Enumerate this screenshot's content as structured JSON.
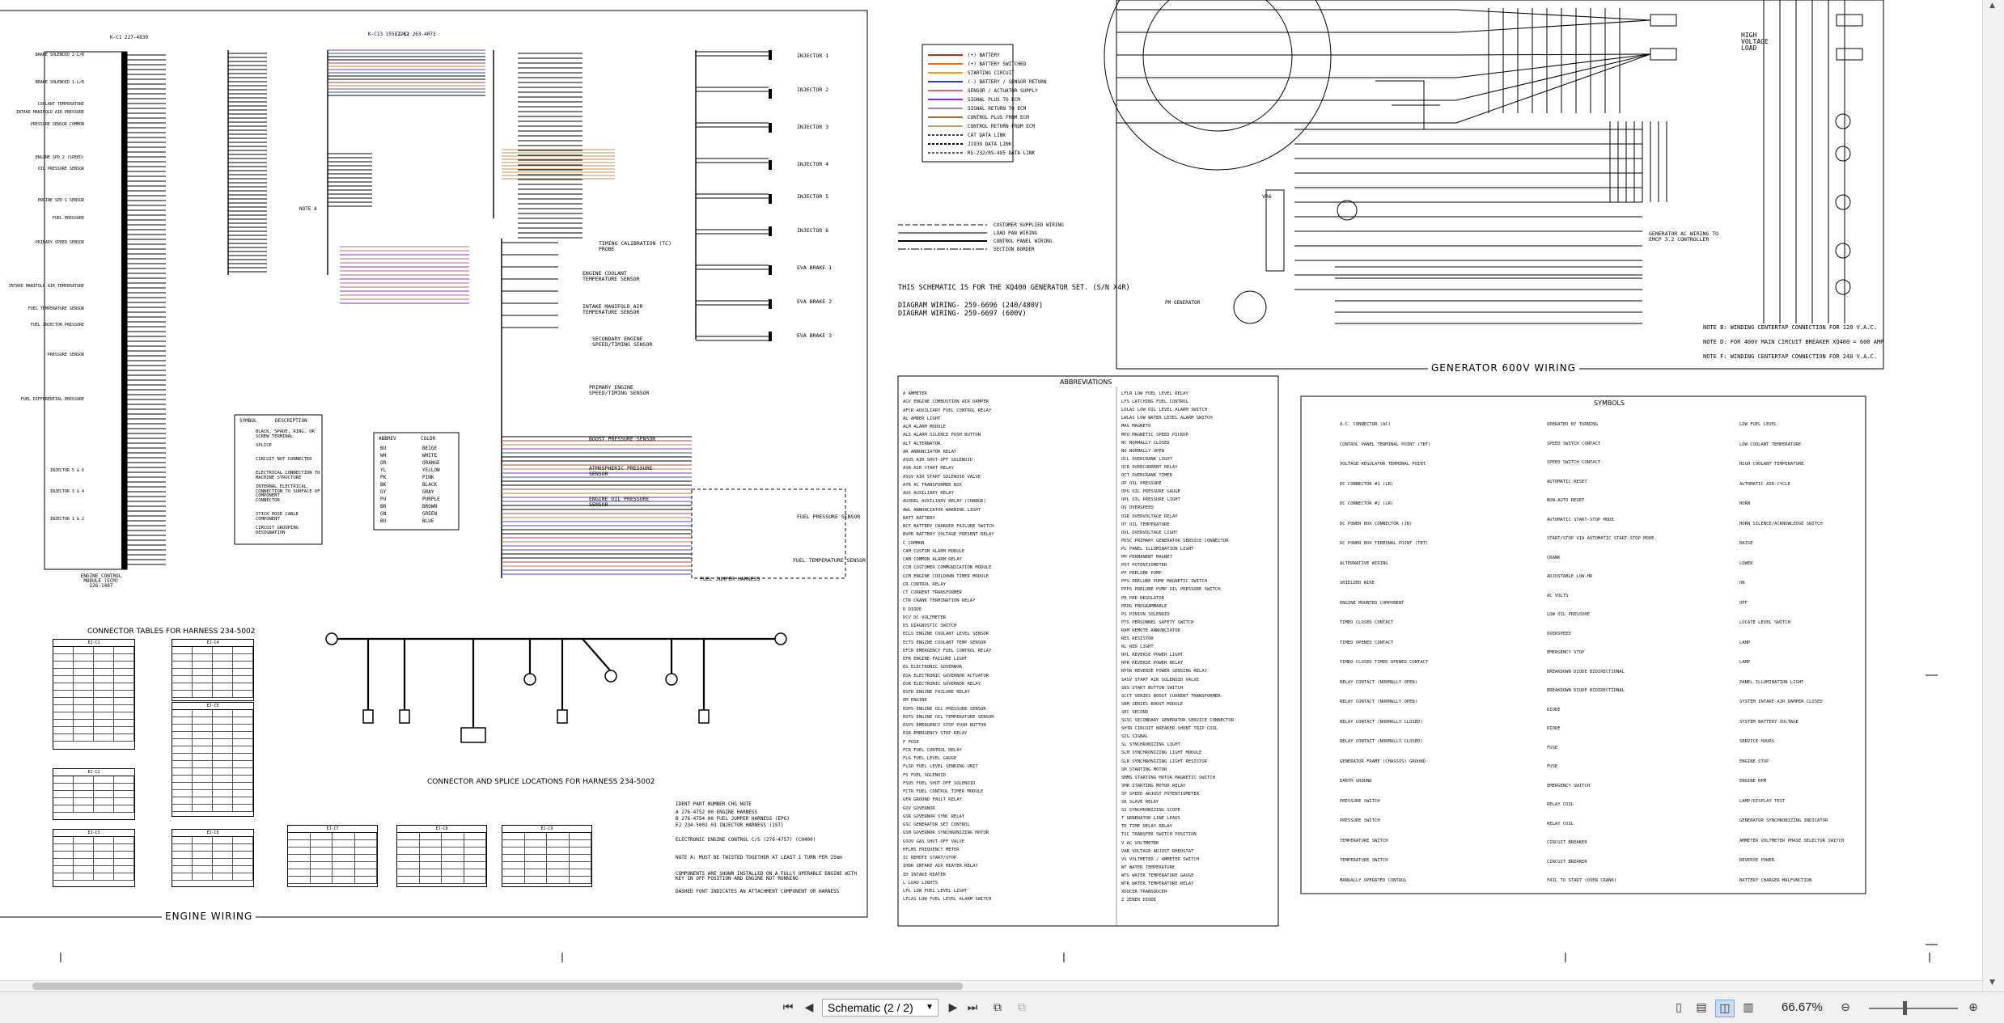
{
  "engine_wiring": {
    "title": "ENGINE WIRING",
    "ecm_label": "ENGINE CONTROL MODULE (ECM) 226-1487",
    "harness_left": "K-C1 227-4830",
    "harness_mid": "K-C13 155-2262",
    "harness_mid2": "EJ-C1 263-4073",
    "left_labels": [
      "BRAKE SOLENOID 2-L/R",
      "BRAKE SOLENOID 1-L/R",
      "COOLANT TEMPERATURE",
      "INTAKE MANIFOLD AIR PRESSURE",
      "PRESSURE SENSOR COMMON",
      "ENGINE SPD 2 (SPEED)",
      "OIL PRESSURE SENSOR",
      "ENGINE SPD 1 SENSOR",
      "FUEL PRESSURE",
      "PRIMARY SPEED SENSOR",
      "INTAKE MANIFOLD AIR TEMPERATURE",
      "FUEL TEMPERATURE SENSOR",
      "FUEL INJECTOR PRESSURE",
      "PRESSURE SENSOR",
      "FUEL DIFFERENTIAL PRESSURE",
      "INJECTOR 5 & 6",
      "INJECTOR 3 & 4",
      "INJECTOR 1 & 2"
    ],
    "components": [
      "TIMING CALIBRATION (TC) PROBE",
      "ENGINE COOLANT TEMPERATURE SENSOR",
      "INTAKE MANIFOLD AIR TEMPERATURE SENSOR",
      "SECONDARY ENGINE SPEED/TIMING SENSOR",
      "PRIMARY ENGINE SPEED/TIMING SENSOR",
      "BOOST PRESSURE SENSOR",
      "ATMOSPHERIC PRESSURE SENSOR",
      "ENGINE OIL PRESSURE SENSOR",
      "FUEL PRESSURE SENSOR",
      "FUEL TEMPERATURE SENSOR",
      "FUEL JUMPER HARNESS"
    ],
    "injectors": [
      "INJECTOR 1",
      "INJECTOR 2",
      "INJECTOR 3",
      "INJECTOR 4",
      "INJECTOR 5",
      "INJECTOR 6",
      "EVA BRAKE 1",
      "EVA BRAKE 2",
      "EVA BRAKE 3"
    ],
    "note_a": "NOTE A",
    "symbol_box": {
      "header": [
        "SYMBOL",
        "DESCRIPTION"
      ],
      "rows": [
        "BLACK, SPADE, RING, OR SCREW TERMINAL",
        "SPLICE",
        "CIRCUIT NOT CONNECTED",
        "ELECTRICAL CONNECTION TO MACHINE STRUCTURE",
        "INTERNAL ELECTRICAL CONNECTION TO SURFACE OF COMPONENT",
        "CONNECTOR",
        "STICK HOSE CABLE COMPONENT",
        "CIRCUIT GROUPING DESIGNATION"
      ]
    },
    "color_box": {
      "header": [
        "ABBREV",
        "COLOR"
      ],
      "rows": [
        [
          "BU",
          "BEIGE"
        ],
        [
          "WH",
          "WHITE"
        ],
        [
          "OR",
          "ORANGE"
        ],
        [
          "YL",
          "YELLOW"
        ],
        [
          "PK",
          "PINK"
        ],
        [
          "BK",
          "BLACK"
        ],
        [
          "GY",
          "GRAY"
        ],
        [
          "PU",
          "PURPLE"
        ],
        [
          "BR",
          "BROWN"
        ],
        [
          "GN",
          "GREEN"
        ],
        [
          "BU",
          "BLUE"
        ]
      ]
    }
  },
  "harness": {
    "connector_title": "CONNECTOR TABLES FOR HARNESS 234-5002",
    "location_title": "CONNECTOR AND SPLICE LOCATIONS FOR HARNESS 234-5002",
    "tables": [
      "EJ-C1",
      "EJ-C4",
      "EJ-C2",
      "EJ-C5",
      "EJ-C3",
      "EJ-C6",
      "EJ-C7",
      "EJ-C8",
      "EJ-C9"
    ]
  },
  "legend": {
    "rows": [
      "(+) BATTERY",
      "(+) BATTERY SWITCHED",
      "STARTING CIRCUIT",
      "(-) BATTERY / SENSOR RETURN",
      "SENSOR / ACTUATOR SUPPLY",
      "SIGNAL PLUS TO ECM",
      "SIGNAL RETURN TO ECM",
      "CONTROL PLUS FROM ECM",
      "CONTROL RETURN FROM ECM",
      "CAT DATA LINK",
      "J1939 DATA LINK",
      "RS-232/RS-485 DATA LINK"
    ],
    "lines": [
      "CUSTOMER SUPPLIED WIRING",
      "LOAD PAN WIRING",
      "CONTROL PANEL WIRING",
      "SECTION BORDER"
    ],
    "schematic_note": "THIS SCHEMATIC IS FOR THE XQ400 GENERATOR SET. (S/N X4R)",
    "diagram1": "DIAGRAM WIRING- 259-6696 (240/480V)",
    "diagram2": "DIAGRAM WIRING- 259-6697 (600V)"
  },
  "generator": {
    "title": "GENERATOR 600V WIRING",
    "high_voltage": "HIGH VOLTAGE LOAD",
    "ac_wiring": "GENERATOR AC WIRING TO EMCP 3.2 CONTROLLER",
    "vr": "VR6",
    "pm": "PM GENERATOR",
    "notes": [
      "NOTE B: WINDING CENTERTAP CONNECTION FOR 120 V.A.C.",
      "NOTE D: FOR 400V MAIN CIRCUIT BREAKER XQ400 = 600 AMP",
      "NOTE F: WINDING CENTERTAP CONNECTION FOR 240 V.A.C."
    ]
  },
  "abbreviations": {
    "title": "ABBREVIATIONS",
    "col1": [
      "A  AMMETER",
      "ACV  ENGINE COMBUSTION AIR DAMPER",
      "AFCR  AUXILIARY FUEL CONTROL RELAY",
      "AL  AMBER LIGHT",
      "ALM  ALARM MODULE",
      "ALS  ALARM SILENCE PUSH BUTTON",
      "ALT  ALTERNATOR",
      "AR  ANNUNCIATOR RELAY",
      "ASOS  AIR SHUT-OFF SOLENOID",
      "ASR  AIR START RELAY",
      "ASSV  AIR START SOLENOID VALVE",
      "ATR  AC TRANSFORMER BOX",
      "AUX  AUXILIARY RELAY",
      "AUXREL  AUXILIARY RELAY (CHANGE)",
      "AWL  ANNUNCIATOR WARNING LIGHT",
      "BATT  BATTERY",
      "BCF  BATTERY CHARGER FAILURE SWITCH",
      "BVPR  BATTERY VOLTAGE PRESENT RELAY",
      "C  COMMON",
      "CAM  CUSTOM ALARM MODULE",
      "CAM  COMMON ALARM RELAY",
      "CCM  CUSTOMER COMMUNICATION MODULE",
      "CCM  ENGINE COOLDOWN TIMER MODULE",
      "CR  CONTROL RELAY",
      "CT  CURRENT TRANSFORMER",
      "CTR  CRANK TERMINATION RELAY",
      "D  DIODE",
      "DCV  DC VOLTMETER",
      "DS  DIAGNOSTIC SWITCH",
      "ECLS  ENGINE COOLANT LEVEL SENSOR",
      "ECTS  ENGINE COOLANT TEMP SENSOR",
      "EFCR  EMERGENCY FUEL CONTROL RELAY",
      "EFR  ENGINE FAILURE LIGHT",
      "EG  ELECTRONIC GOVERNOR",
      "EGA  ELECTRONIC GOVERNOR ACTUATOR",
      "EGR  ELECTRONIC GOVERNOR RELAY",
      "EGFR  ENGINE FAILURE RELAY",
      "EM  ENGINE",
      "EOPS  ENGINE OIL PRESSURE SENSOR",
      "EOTS  ENGINE OIL TEMPERATURE SENSOR",
      "ESPS  EMERGENCY STOP PUSH BUTTON",
      "ESR  EMERGENCY STOP RELAY",
      "F  FUSE",
      "FCR  FUEL CONTROL RELAY",
      "FLG  FUEL LEVEL GAUGE",
      "FLSD  FUEL LEVEL SENDING UNIT",
      "FS  FUEL SOLENOID",
      "FSOS  FUEL SHUT-OFF SOLENOID",
      "FCTR  FUEL CONTROL TIMER MODULE",
      "GFR  GROUND FAULT RELAY",
      "GOV  GOVERNOR",
      "GSR  GOVERNOR SYNC RELAY",
      "GSC  GENERATOR SET CONTROL",
      "GSM  GOVERNOR SYNCHRONIZING MOTOR",
      "GSOV  GAS SHUT-OFF VALVE",
      "HFLMS  FREQUENCY METER",
      "IC  REMOTE START/STOP",
      "IHDR  INTAKE AIR HEATER RELAY",
      "IH  INTAKE HEATER",
      "L  LOAD LIGHTS",
      "LFL  LOW FUEL LEVEL LIGHT",
      "LFLAS  LOW FUEL LEVEL ALARM SWITCH"
    ],
    "col2": [
      "LFLR  LOW FUEL LEVEL RELAY",
      "LFS  LATCHING FUEL CONTROL",
      "LOLAS  LOW OIL LEVEL ALARM SWITCH",
      "LWLAS  LOW WATER LEVEL ALARM SWITCH",
      "MAG  MAGNETO",
      "MPU  MAGNETIC SPEED PICKUP",
      "NC  NORMALLY CLOSED",
      "NO  NORMALLY OPEN",
      "OCL  OVERCRANK LIGHT",
      "OCR  OVERCURRENT RELAY",
      "OCT  OVERCRANK TIMER",
      "OP  OIL PRESSURE",
      "OPG  OIL PRESSURE GAUGE",
      "OPL  OIL PRESSURE LIGHT",
      "OS  OVERSPEED",
      "OSR  OVERVOLTAGE RELAY",
      "OT  OIL TEMPERATURE",
      "OVL  OVERVOLTAGE LIGHT",
      "PDSC  PRIMARY GENERATOR SERVICE CONNECTOR",
      "PL  PANEL ILLUMINATION LIGHT",
      "PM  PERMANENT MAGNET",
      "POT  POTENTIOMETER",
      "PP  PRELUBE PUMP",
      "PPS  PRELUBE PUMP MAGNETIC SWITCH",
      "PPPS  PRELUBE PUMP OIL PRESSURE SWITCH",
      "PR  PRE-REGULATOR",
      "PROG  PROGRAMMABLE",
      "PS  PINION SOLENOID",
      "PTS  PERSONNEL SAFETY SWITCH",
      "RAM  REMOTE ANNUNCIATOR",
      "RES  RESISTOR",
      "RL  RED LIGHT",
      "RPL  REVERSE POWER LIGHT",
      "RPR  REVERSE POWER RELAY",
      "RPSR  REVERSE POWER SENSING RELAY",
      "SASV  START AIR SOLENOID VALVE",
      "SBS  START BUTTON SWITCH",
      "SCCT  SERIES BOOST CURRENT TRANSFORMER",
      "SBM  SERIES BOOST MODULE",
      "SEC  SECOND",
      "SGSC  SECONDARY GENERATOR SERVICE CONNECTOR",
      "SHTR  CIRCUIT BREAKER SHUNT TRIP COIL",
      "SIG  SIGNAL",
      "SL  SYNCHRONIZING LIGHT",
      "SLM  SYNCHRONIZING LIGHT MODULE",
      "SLR  SYNCHRONIZING LIGHT RESISTOR",
      "SM  STARTING MOTOR",
      "SMMS  STARTING MOTOR MAGNETIC SWITCH",
      "SMR  STARTING MOTOR RELAY",
      "SP  SPEED ADJUST POTENTIOMETER",
      "SR  SLAVE RELAY",
      "SS  SYNCHRONIZING SCOPE",
      "T  GENERATOR LINE LEADS",
      "TD  TIME DELAY RELAY",
      "TSC  TRANSFER SWITCH POSITION",
      "V  AC VOLTMETER",
      "VAR  VOLTAGE ADJUST RHEOSTAT",
      "VS  VOLTMETER / AMMETER SWITCH",
      "WT  WATER TEMPERATURE",
      "WTG  WATER TEMPERATURE GAUGE",
      "WTR  WATER TEMPERATURE RELAY",
      "XDUCER  TRANSDUCER",
      "Z  ZENER DIODE"
    ]
  },
  "symbols": {
    "title": "SYMBOLS",
    "col1": [
      "A.C. CONNECTOR (AC)",
      "CONTROL PANEL TERMINAL POINT (TBT)",
      "VOLTAGE REGULATOR TERMINAL POINT",
      "DC CONNECTOR #1 (LR)",
      "DC CONNECTOR #2 (LR)",
      "DC POWER BOX CONNECTOR (JB)",
      "DC POWER BOX TERMINAL POINT (TBT)",
      "ALTERNATIVE WIRING",
      "SHIELDED WIRE",
      "ENGINE MOUNTED COMPONENT",
      "TIMED CLOSED CONTACT",
      "TIMED OPENED CONTACT",
      "TIMED CLOSED TIMED OPENED CONTACT",
      "RELAY CONTACT (NORMALLY OPEN)",
      "RELAY CONTACT (NORMALLY OPEN)",
      "RELAY CONTACT (NORMALLY CLOSED)",
      "RELAY CONTACT (NORMALLY CLOSED)",
      "GENERATOR FRAME (CHASSIS) GROUND",
      "EARTH GROUND",
      "PRESSURE SWITCH",
      "PRESSURE SWITCH",
      "TEMPERATURE SWITCH",
      "TEMPERATURE SWITCH",
      "MANUALLY OPERATED CONTROL"
    ],
    "col2": [
      "OPERATED BY TURNING",
      "SPEED SWITCH CONTACT",
      "SPEED SWITCH CONTACT",
      "AUTOMATIC RESET",
      "NON-AUTO RESET",
      "AUTOMATIC START-STOP MODE",
      "START/STOP VIA AUTOMATIC START-STOP MODE",
      "CRANK",
      "ADJUSTABLE LOW-HR",
      "AC VOLTS",
      "LOW OIL PRESSURE",
      "OVERSPEED",
      "EMERGENCY STOP",
      "BREAKDOWN DIODE BIDIRECTIONAL",
      "BREAKDOWN DIODE BIDIRECTIONAL",
      "DIODE",
      "DIODE",
      "FUSE",
      "FUSE",
      "EMERGENCY SWITCH",
      "RELAY COIL",
      "RELAY COIL",
      "CIRCUIT BREAKER",
      "CIRCUIT BREAKER",
      "FAIL TO START (OVER CRANK)"
    ],
    "col3": [
      "LOW FUEL LEVEL",
      "LOW COOLANT TEMPERATURE",
      "HIGH COOLANT TEMPERATURE",
      "AUTOMATIC AIR-CYCLE",
      "HORN",
      "HORN SILENCE/ACKNOWLEDGE SWITCH",
      "RAISE",
      "LOWER",
      "ON",
      "OFF",
      "LOCATE LEVEL SWITCH",
      "LAMP",
      "LAMP",
      "PANEL ILLUMINATION LIGHT",
      "SYSTEM INTAKE AIR DAMPER CLOSED",
      "SYSTEM BATTERY VOLTAGE",
      "SERVICE HOURS",
      "ENGINE STOP",
      "ENGINE RPM",
      "LAMP/DISPLAY TEST",
      "GENERATOR SYNCHRONIZING INDICATOR",
      "AMMETER VOLTMETER PHASE SELECTOR SWITCH",
      "REVERSE POWER",
      "BATTERY CHARGER MALFUNCTION"
    ]
  },
  "notes": {
    "part_table_header": "IDENT  PART NUMBER  CHG  NOTE",
    "parts": [
      "A  276-4752  00  ENGINE HARNESS",
      "B  276-4754  00  FUEL JUMPER HARNESS (EPG)",
      "EJ  234-5002  03  INJECTOR HARNESS (1ST)"
    ],
    "ecm_note": "ELECTRONIC ENGINE CONTROL C/S (276-4757) (CH400)",
    "note_a": "NOTE A:  MUST BE TWISTED TOGETHER AT LEAST 1 TURN PER 25mm",
    "components_note": "COMPONENTS ARE SHOWN INSTALLED ON A FULLY OPERABLE ENGINE WITH KEY IN OFF POSITION AND ENGINE NOT RUNNING",
    "dashed_note": "DASHED FONT INDICATES AN ATTACHMENT COMPONENT OR HARNESS"
  },
  "viewer": {
    "page_select": "Schematic (2 / 2)",
    "zoom": "66.67%",
    "first_icon": "first-page-icon",
    "prev_icon": "prev-page-icon",
    "next_icon": "next-page-icon",
    "last_icon": "last-page-icon"
  }
}
